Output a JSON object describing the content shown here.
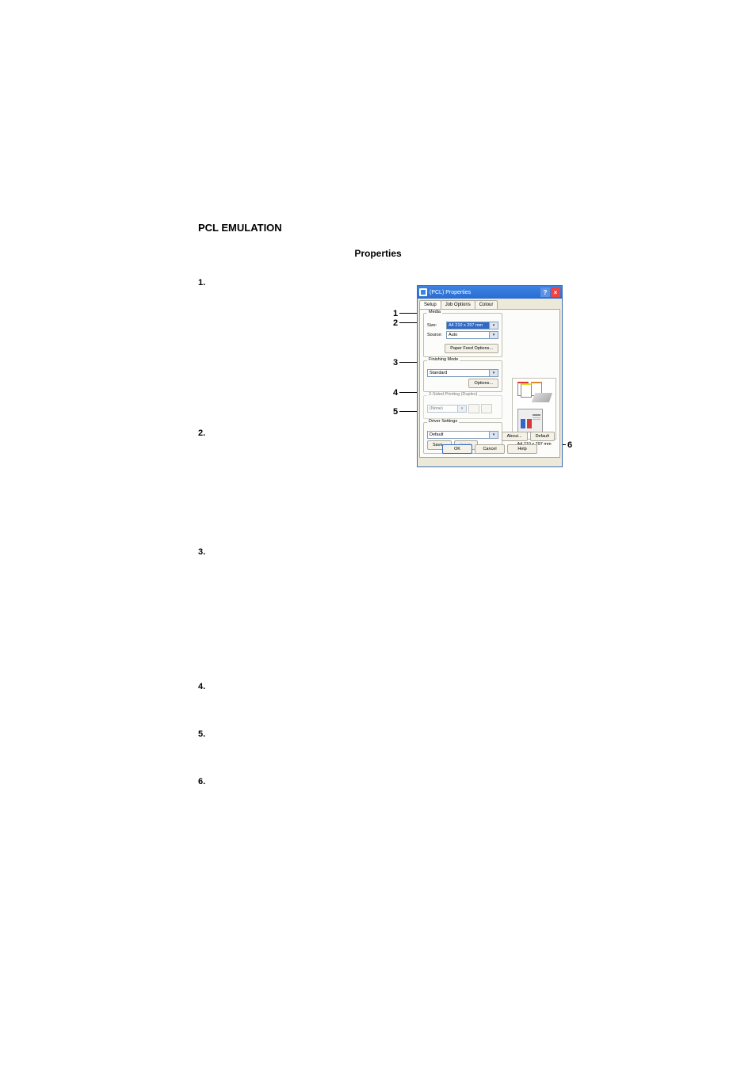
{
  "section_title": "PCL EMULATION",
  "sub_title": "Properties",
  "list": {
    "n1": "1.",
    "n2": "2.",
    "n3": "3.",
    "n4": "4.",
    "n5": "5.",
    "n6": "6."
  },
  "callouts": {
    "c1": "1",
    "c2": "2",
    "c3": "3",
    "c4": "4",
    "c5": "5",
    "c6": "6"
  },
  "dialog": {
    "title": "(PCL) Properties",
    "tabs": {
      "setup": "Setup",
      "job": "Job Options",
      "colour": "Colour"
    },
    "media": {
      "legend": "Media",
      "size_label": "Size:",
      "size_value": "A4 210 x 297 mm",
      "source_label": "Source:",
      "source_value": "Auto",
      "feed_btn": "Paper Feed Options..."
    },
    "finishing": {
      "legend": "Finishing Mode",
      "value": "Standard",
      "options_btn": "Options..."
    },
    "duplex": {
      "legend": "2-Sided Printing (Duplex)",
      "value": "(None)"
    },
    "driver": {
      "legend": "Driver Settings",
      "value": "Default",
      "save_btn": "Save...",
      "delete_btn": "Delete"
    },
    "preview_label": "A4 210 x 297 mm",
    "about_btn": "About...",
    "default_btn": "Default",
    "ok_btn": "OK",
    "cancel_btn": "Cancel",
    "help_btn": "Help"
  }
}
